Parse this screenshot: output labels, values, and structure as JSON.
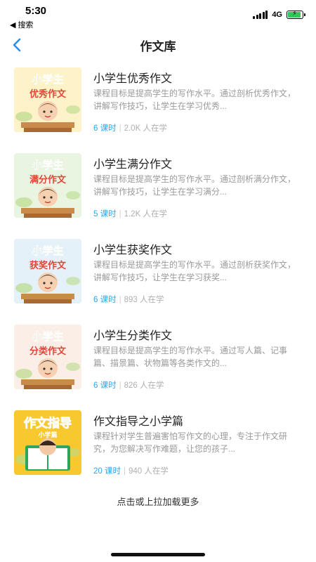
{
  "status_bar": {
    "time": "5:30",
    "back_label": "◀ 搜索",
    "network": "4G",
    "battery_percent": 90
  },
  "nav": {
    "title": "作文库"
  },
  "courses": [
    {
      "title": "小学生优秀作文",
      "description": "课程目标是提高学生的写作水平。通过剖析优秀作文，讲解写作技巧，让学生在学习优秀...",
      "lessons": "6 课时",
      "learners": "2.0K 人在学",
      "thumb_line1": "小学生",
      "thumb_line2": "优秀作文",
      "thumb_bg": "#fdf2c8",
      "thumb_line2_color": "#e24638"
    },
    {
      "title": "小学生满分作文",
      "description": "课程目标是提高学生的写作水平。通过剖析满分作文，讲解写作技巧，让学生在学习满分...",
      "lessons": "5 课时",
      "learners": "1.2K 人在学",
      "thumb_line1": "小学生",
      "thumb_line2": "满分作文",
      "thumb_bg": "#e9f4e1",
      "thumb_line2_color": "#e24638"
    },
    {
      "title": "小学生获奖作文",
      "description": "课程目标是提高学生的写作水平。通过剖析获奖作文，讲解写作技巧，让学生在学习获奖...",
      "lessons": "6 课时",
      "learners": "893 人在学",
      "thumb_line1": "小学生",
      "thumb_line2": "获奖作文",
      "thumb_bg": "#e4f1f8",
      "thumb_line2_color": "#e24638"
    },
    {
      "title": "小学生分类作文",
      "description": "课程目标是提高学生的写作水平。通过写人篇、记事篇、描景篇、状物篇等各类作文的...",
      "lessons": "6 课时",
      "learners": "826 人在学",
      "thumb_line1": "小学生",
      "thumb_line2": "分类作文",
      "thumb_bg": "#fbeee6",
      "thumb_line2_color": "#e24638"
    },
    {
      "title": "作文指导之小学篇",
      "description": "课程针对学生普遍害怕写作文的心理，专注于作文研究，为您解决写作难题，让您的孩子...",
      "lessons": "20 课时",
      "learners": "940 人在学",
      "thumb_line1": "作文指导",
      "thumb_line2": "小学篇",
      "thumb_bg": "#f7c92e",
      "thumb_line2_color": "#ffffff"
    }
  ],
  "load_more": "点击或上拉加载更多",
  "colors": {
    "accent": "#2aa5f0",
    "title": "#222222",
    "desc": "#9a9a9a"
  }
}
